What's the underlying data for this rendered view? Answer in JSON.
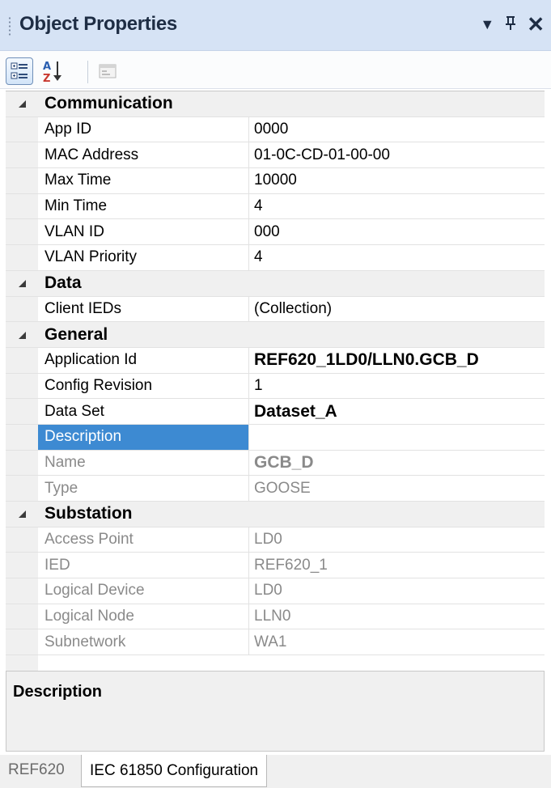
{
  "panel": {
    "title": "Object Properties",
    "controls": {
      "dropdown": "▼",
      "pin": "ᵻ",
      "close": "✕"
    }
  },
  "toolbar": {
    "buttons": [
      {
        "name": "categorized-button",
        "icon": "categorized-icon",
        "active": true
      },
      {
        "name": "alphabetical-button",
        "icon": "sort-az-icon",
        "active": false
      },
      {
        "name": "property-pages-button",
        "icon": "property-pages-icon",
        "active": false,
        "disabled": true
      }
    ]
  },
  "grid": {
    "categories": [
      {
        "label": "Communication",
        "rows": [
          {
            "name": "App ID",
            "value": "0000"
          },
          {
            "name": "MAC Address",
            "value": "01-0C-CD-01-00-00"
          },
          {
            "name": "Max Time",
            "value": "10000"
          },
          {
            "name": "Min Time",
            "value": "4"
          },
          {
            "name": "VLAN ID",
            "value": "000"
          },
          {
            "name": "VLAN Priority",
            "value": "4"
          }
        ]
      },
      {
        "label": "Data",
        "rows": [
          {
            "name": "Client IEDs",
            "value": "(Collection)"
          }
        ]
      },
      {
        "label": "General",
        "rows": [
          {
            "name": "Application Id",
            "value": "REF620_1LD0/LLN0.GCB_D",
            "bold": true
          },
          {
            "name": "Config Revision",
            "value": "1"
          },
          {
            "name": "Data Set",
            "value": "Dataset_A",
            "bold": true
          },
          {
            "name": "Description",
            "value": "",
            "selected": true
          },
          {
            "name": "Name",
            "value": "GCB_D",
            "bold": true,
            "readonly": true
          },
          {
            "name": "Type",
            "value": "GOOSE",
            "readonly": true
          }
        ]
      },
      {
        "label": "Substation",
        "rows": [
          {
            "name": "Access Point",
            "value": "LD0",
            "readonly": true
          },
          {
            "name": "IED",
            "value": "REF620_1",
            "readonly": true
          },
          {
            "name": "Logical Device",
            "value": "LD0",
            "readonly": true
          },
          {
            "name": "Logical Node",
            "value": "LLN0",
            "readonly": true
          },
          {
            "name": "Subnetwork",
            "value": "WA1",
            "readonly": true
          }
        ]
      }
    ]
  },
  "description_panel": {
    "title": "Description"
  },
  "tabs": [
    {
      "label": "REF620",
      "active": false
    },
    {
      "label": "IEC 61850 Configuration",
      "active": true
    }
  ],
  "colors": {
    "title_bar": "#d6e3f5",
    "selection": "#3d8ad2",
    "readonly_text": "#8a8a8a"
  }
}
